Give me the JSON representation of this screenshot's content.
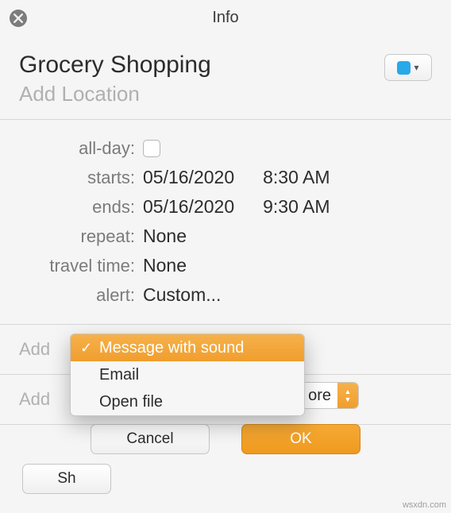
{
  "window": {
    "title": "Info"
  },
  "event": {
    "title": "Grocery Shopping",
    "location_placeholder": "Add Location"
  },
  "fields": {
    "allday_label": "all-day:",
    "starts_label": "starts:",
    "starts_date": "05/16/2020",
    "starts_time": "8:30 AM",
    "ends_label": "ends:",
    "ends_date": "05/16/2020",
    "ends_time": "9:30 AM",
    "repeat_label": "repeat:",
    "repeat_value": "None",
    "travel_label": "travel time:",
    "travel_value": "None",
    "alert_label": "alert:",
    "alert_value": "Custom..."
  },
  "sections": {
    "add_notes_prefix": "Add",
    "add_attachments_prefix": "Add"
  },
  "popover": {
    "options": [
      {
        "label": "Message with sound",
        "selected": true
      },
      {
        "label": "Email",
        "selected": false
      },
      {
        "label": "Open file",
        "selected": false
      }
    ],
    "partial_btn": "ore"
  },
  "buttons": {
    "cancel": "Cancel",
    "ok": "OK",
    "show_partial": "Sh"
  },
  "watermark": "wsxdn.com"
}
